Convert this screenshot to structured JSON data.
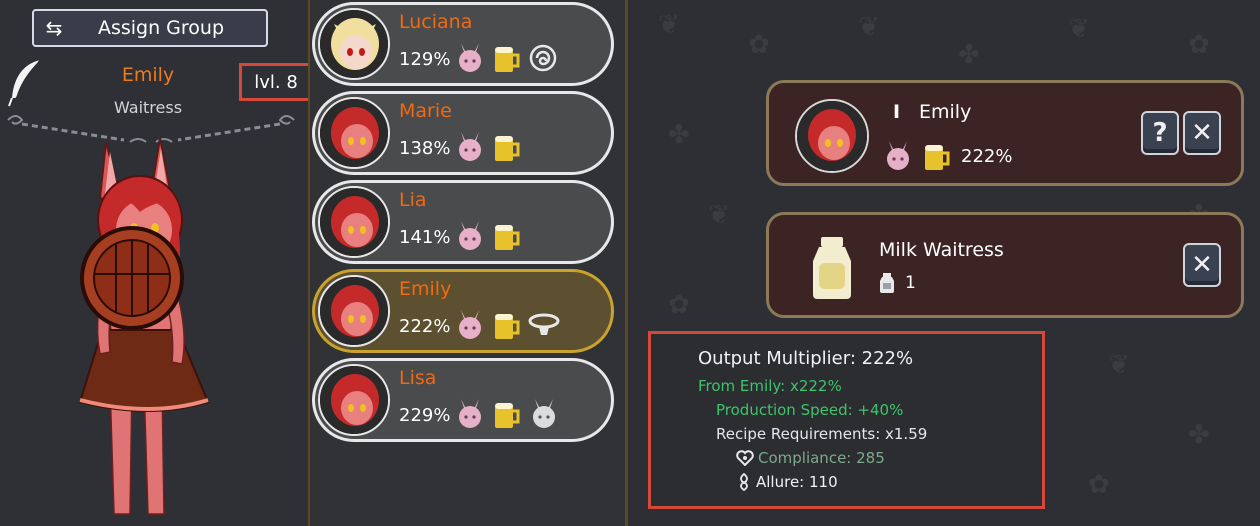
{
  "header": {
    "assign_group_label": "Assign Group"
  },
  "character": {
    "name": "Emily",
    "role": "Waitress",
    "level": "lvl. 8"
  },
  "workers": [
    {
      "name": "Luciana",
      "pct": "129%",
      "extra_icon": "spiral-icon",
      "hair": "#f1dfa0"
    },
    {
      "name": "Marie",
      "pct": "138%",
      "extra_icon": "",
      "hair": "#c52a2a"
    },
    {
      "name": "Lia",
      "pct": "141%",
      "extra_icon": "",
      "hair": "#c52a2a"
    },
    {
      "name": "Emily",
      "pct": "222%",
      "extra_icon": "collar-icon",
      "hair": "#c52a2a",
      "selected": true
    },
    {
      "name": "Lisa",
      "pct": "229%",
      "extra_icon": "bunny-face-icon",
      "hair": "#c52a2a"
    }
  ],
  "assigned_card": {
    "rank": "I",
    "name": "Emily",
    "pct": "222%",
    "help_label": "?",
    "close_label": "✕"
  },
  "recipe_card": {
    "name": "Milk Waitress",
    "count": "1",
    "close_label": "✕"
  },
  "tooltip": {
    "main": "Output Multiplier: 222%",
    "from": "From Emily: x222%",
    "speed": "Production Speed: +40%",
    "recipe": "Recipe Requirements: x1.59",
    "compliance": "Compliance: 285",
    "allure": "Allure: 110"
  },
  "colors": {
    "name_orange": "#f06a10",
    "highlight_red": "#d6483a",
    "selected_gold": "#c9a32b",
    "green_stat": "#3ec46a"
  }
}
